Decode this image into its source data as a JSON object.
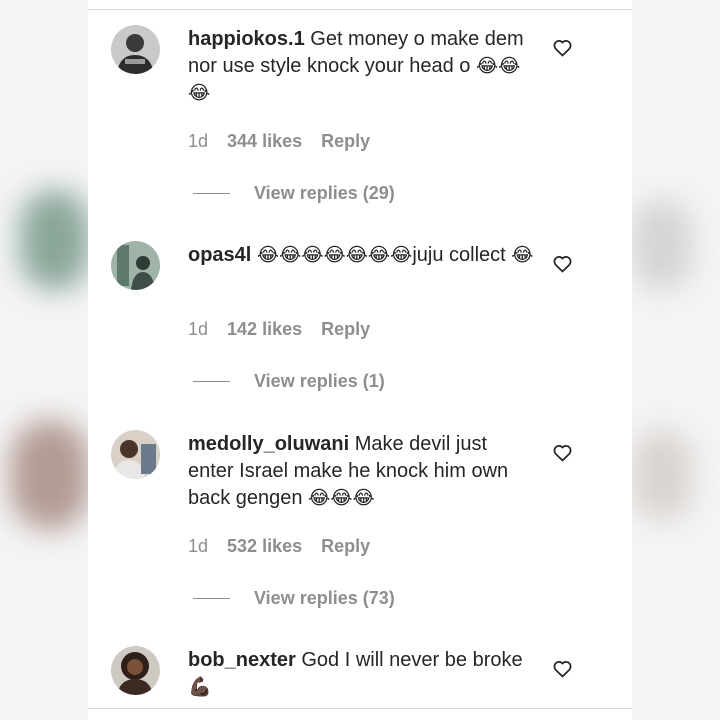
{
  "comments": [
    {
      "username": "happiokos.1",
      "text": "Get money o make dem nor use style knock your head o",
      "emojis": "😂😂😂",
      "time": "1d",
      "likes": "344 likes",
      "reply": "Reply",
      "view_replies": "View replies (29)"
    },
    {
      "username": "opas4l",
      "emojis_before": "😂😂😂😂😂😂😂",
      "text": "juju collect",
      "emojis": "😂",
      "time": "1d",
      "likes": "142 likes",
      "reply": "Reply",
      "view_replies": "View replies (1)"
    },
    {
      "username": "medolly_oluwani",
      "text": "Make devil just enter Israel make he knock him own back gengen",
      "emojis": "😂😂😂",
      "time": "1d",
      "likes": "532 likes",
      "reply": "Reply",
      "view_replies": "View replies (73)"
    },
    {
      "username": "bob_nexter",
      "text": "God I will never be broke",
      "emojis": "💪🏿"
    }
  ],
  "colors": {
    "text": "#262626",
    "meta": "#8e8e8e",
    "divider": "#d6d6d6"
  }
}
